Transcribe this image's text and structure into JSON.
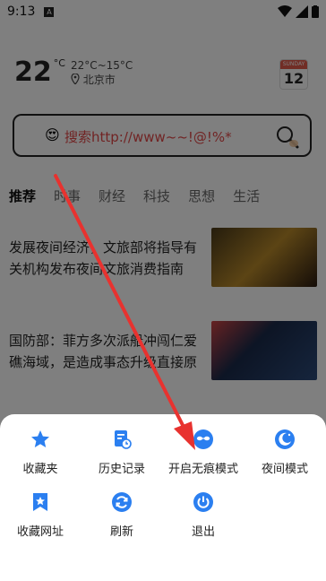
{
  "status_bar": {
    "time": "9:13",
    "notification_badge": "A"
  },
  "weather": {
    "temperature": "22",
    "unit": "°C",
    "range": "22°C~15°C",
    "location": "北京市"
  },
  "calendar": {
    "month": "SUNDAY",
    "day": "12"
  },
  "search": {
    "emoji": "😍",
    "placeholder": "搜索http://www~~!@!%*"
  },
  "tabs": [
    {
      "label": "推荐",
      "active": true
    },
    {
      "label": "时事",
      "active": false
    },
    {
      "label": "财经",
      "active": false
    },
    {
      "label": "科技",
      "active": false
    },
    {
      "label": "思想",
      "active": false
    },
    {
      "label": "生活",
      "active": false
    }
  ],
  "news": [
    {
      "title": "发展夜间经济，文旅部将指导有关机构发布夜间文旅消费指南"
    },
    {
      "title": "国防部：菲方多次派船冲闯仁爱礁海域，是造成事态升级直接原"
    }
  ],
  "menu": {
    "items": [
      {
        "label": "收藏夹",
        "icon": "star-icon"
      },
      {
        "label": "历史记录",
        "icon": "history-icon"
      },
      {
        "label": "开启无痕模式",
        "icon": "incognito-icon"
      },
      {
        "label": "夜间模式",
        "icon": "night-mode-icon"
      },
      {
        "label": "收藏网址",
        "icon": "bookmark-icon"
      },
      {
        "label": "刷新",
        "icon": "refresh-icon"
      },
      {
        "label": "退出",
        "icon": "power-icon"
      }
    ]
  },
  "colors": {
    "accent": "#2b7ff0",
    "arrow": "#e8322f",
    "search_text": "#e24848"
  }
}
